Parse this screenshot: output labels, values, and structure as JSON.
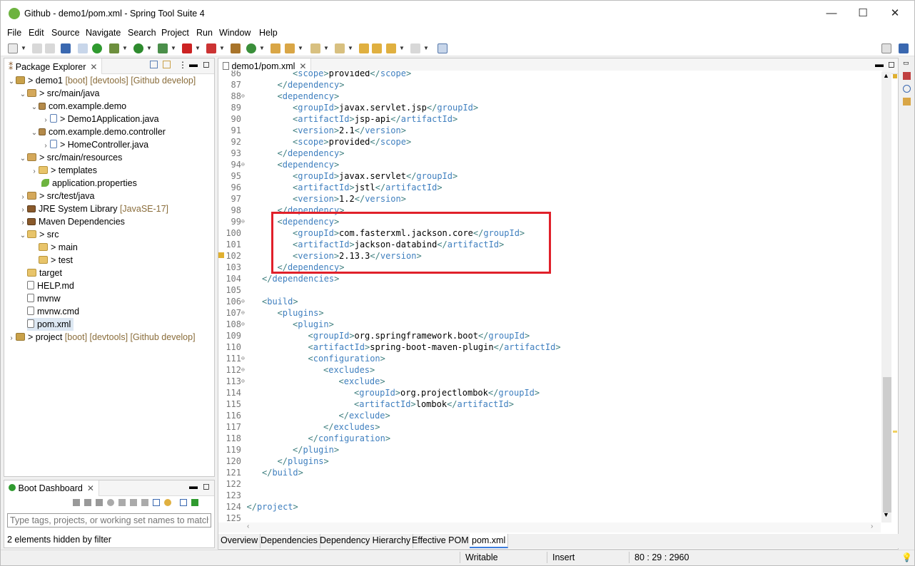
{
  "window": {
    "title": "Github - demo1/pom.xml - Spring Tool Suite 4",
    "minimize": "—",
    "maximize": "☐",
    "close": "✕"
  },
  "menu": [
    "File",
    "Edit",
    "Source",
    "Navigate",
    "Search",
    "Project",
    "Run",
    "Window",
    "Help"
  ],
  "package_explorer": {
    "tab_label": "Package Explorer",
    "tree": [
      {
        "label": "demo1",
        "deco": "[boot] [devtools] [Github develop]",
        "prefix": "> "
      },
      {
        "label": "src/main/java",
        "prefix": "> "
      },
      {
        "label": "com.example.demo"
      },
      {
        "label": "Demo1Application.java",
        "prefix": "> "
      },
      {
        "label": "com.example.demo.controller"
      },
      {
        "label": "HomeController.java",
        "prefix": "> "
      },
      {
        "label": "src/main/resources",
        "prefix": "> "
      },
      {
        "label": "templates",
        "prefix": "> "
      },
      {
        "label": "application.properties"
      },
      {
        "label": "src/test/java",
        "prefix": "> "
      },
      {
        "label": "JRE System Library",
        "deco": "[JavaSE-17]"
      },
      {
        "label": "Maven Dependencies"
      },
      {
        "label": "src",
        "prefix": "> "
      },
      {
        "label": "main",
        "prefix": "> "
      },
      {
        "label": "test",
        "prefix": "> "
      },
      {
        "label": "target"
      },
      {
        "label": "HELP.md"
      },
      {
        "label": "mvnw"
      },
      {
        "label": "mvnw.cmd"
      },
      {
        "label": "pom.xml"
      },
      {
        "label": "project",
        "deco": "[boot] [devtools] [Github develop]",
        "prefix": "> "
      }
    ]
  },
  "boot_dashboard": {
    "tab_label": "Boot Dashboard",
    "filter_placeholder": "Type tags, projects, or working set names to match",
    "hidden_text": "2 elements hidden by filter"
  },
  "editor": {
    "tab_label": "demo1/pom.xml",
    "lines": [
      {
        "n": "86",
        "indent": 2,
        "parts": [
          [
            "t",
            "<"
          ],
          [
            "n",
            "scope"
          ],
          [
            "x",
            ">provided</"
          ],
          [
            "n",
            "scope"
          ],
          [
            "t",
            ">"
          ]
        ]
      },
      {
        "n": "87",
        "indent": 1,
        "parts": [
          [
            "t",
            "</"
          ],
          [
            "n",
            "dependency"
          ],
          [
            "t",
            ">"
          ]
        ]
      },
      {
        "n": "88",
        "fold": true,
        "indent": 1,
        "parts": [
          [
            "t",
            "<"
          ],
          [
            "n",
            "dependency"
          ],
          [
            "t",
            ">"
          ]
        ]
      },
      {
        "n": "89",
        "indent": 2,
        "parts": [
          [
            "t",
            "<"
          ],
          [
            "n",
            "groupId"
          ],
          [
            "x",
            ">javax.servlet.jsp</"
          ],
          [
            "n",
            "groupId"
          ],
          [
            "t",
            ">"
          ]
        ]
      },
      {
        "n": "90",
        "indent": 2,
        "parts": [
          [
            "t",
            "<"
          ],
          [
            "n",
            "artifactId"
          ],
          [
            "x",
            ">jsp-api</"
          ],
          [
            "n",
            "artifactId"
          ],
          [
            "t",
            ">"
          ]
        ]
      },
      {
        "n": "91",
        "indent": 2,
        "parts": [
          [
            "t",
            "<"
          ],
          [
            "n",
            "version"
          ],
          [
            "x",
            ">2.1</"
          ],
          [
            "n",
            "version"
          ],
          [
            "t",
            ">"
          ]
        ]
      },
      {
        "n": "92",
        "indent": 2,
        "parts": [
          [
            "t",
            "<"
          ],
          [
            "n",
            "scope"
          ],
          [
            "x",
            ">provided</"
          ],
          [
            "n",
            "scope"
          ],
          [
            "t",
            ">"
          ]
        ]
      },
      {
        "n": "93",
        "indent": 1,
        "parts": [
          [
            "t",
            "</"
          ],
          [
            "n",
            "dependency"
          ],
          [
            "t",
            ">"
          ]
        ]
      },
      {
        "n": "94",
        "fold": true,
        "indent": 1,
        "parts": [
          [
            "t",
            "<"
          ],
          [
            "n",
            "dependency"
          ],
          [
            "t",
            ">"
          ]
        ]
      },
      {
        "n": "95",
        "indent": 2,
        "parts": [
          [
            "t",
            "<"
          ],
          [
            "n",
            "groupId"
          ],
          [
            "x",
            ">javax.servlet</"
          ],
          [
            "n",
            "groupId"
          ],
          [
            "t",
            ">"
          ]
        ]
      },
      {
        "n": "96",
        "indent": 2,
        "parts": [
          [
            "t",
            "<"
          ],
          [
            "n",
            "artifactId"
          ],
          [
            "x",
            ">jstl</"
          ],
          [
            "n",
            "artifactId"
          ],
          [
            "t",
            ">"
          ]
        ]
      },
      {
        "n": "97",
        "indent": 2,
        "parts": [
          [
            "t",
            "<"
          ],
          [
            "n",
            "version"
          ],
          [
            "x",
            ">1.2</"
          ],
          [
            "n",
            "version"
          ],
          [
            "t",
            ">"
          ]
        ]
      },
      {
        "n": "98",
        "indent": 1,
        "parts": [
          [
            "t",
            "</"
          ],
          [
            "n",
            "dependency"
          ],
          [
            "t",
            ">"
          ]
        ]
      },
      {
        "n": "99",
        "fold": true,
        "indent": 1,
        "parts": [
          [
            "t",
            "<"
          ],
          [
            "n",
            "dependency"
          ],
          [
            "t",
            ">"
          ]
        ]
      },
      {
        "n": "100",
        "indent": 2,
        "parts": [
          [
            "t",
            "<"
          ],
          [
            "n",
            "groupId"
          ],
          [
            "x",
            ">com.fasterxml.jackson.core</"
          ],
          [
            "n",
            "groupId"
          ],
          [
            "t",
            ">"
          ]
        ]
      },
      {
        "n": "101",
        "indent": 2,
        "parts": [
          [
            "t",
            "<"
          ],
          [
            "n",
            "artifactId"
          ],
          [
            "x",
            ">jackson-databind</"
          ],
          [
            "n",
            "artifactId"
          ],
          [
            "t",
            ">"
          ]
        ]
      },
      {
        "n": "102",
        "warn": true,
        "indent": 2,
        "parts": [
          [
            "t",
            "<"
          ],
          [
            "n",
            "version"
          ],
          [
            "x",
            ">2.13.3</"
          ],
          [
            "n",
            "version"
          ],
          [
            "t",
            ">"
          ]
        ]
      },
      {
        "n": "103",
        "indent": 1,
        "parts": [
          [
            "t",
            "</"
          ],
          [
            "n",
            "dependency"
          ],
          [
            "t",
            ">"
          ]
        ]
      },
      {
        "n": "104",
        "indent": 0,
        "parts": [
          [
            "t",
            "</"
          ],
          [
            "n",
            "dependencies"
          ],
          [
            "t",
            ">"
          ]
        ]
      },
      {
        "n": "105",
        "indent": 0,
        "parts": []
      },
      {
        "n": "106",
        "fold": true,
        "indent": 0,
        "parts": [
          [
            "t",
            "<"
          ],
          [
            "n",
            "build"
          ],
          [
            "t",
            ">"
          ]
        ]
      },
      {
        "n": "107",
        "fold": true,
        "indent": 1,
        "parts": [
          [
            "t",
            "<"
          ],
          [
            "n",
            "plugins"
          ],
          [
            "t",
            ">"
          ]
        ]
      },
      {
        "n": "108",
        "fold": true,
        "indent": 2,
        "parts": [
          [
            "t",
            "<"
          ],
          [
            "n",
            "plugin"
          ],
          [
            "t",
            ">"
          ]
        ]
      },
      {
        "n": "109",
        "indent": 3,
        "parts": [
          [
            "t",
            "<"
          ],
          [
            "n",
            "groupId"
          ],
          [
            "x",
            ">org.springframework.boot</"
          ],
          [
            "n",
            "groupId"
          ],
          [
            "t",
            ">"
          ]
        ]
      },
      {
        "n": "110",
        "indent": 3,
        "parts": [
          [
            "t",
            "<"
          ],
          [
            "n",
            "artifactId"
          ],
          [
            "x",
            ">spring-boot-maven-plugin</"
          ],
          [
            "n",
            "artifactId"
          ],
          [
            "t",
            ">"
          ]
        ]
      },
      {
        "n": "111",
        "fold": true,
        "indent": 3,
        "parts": [
          [
            "t",
            "<"
          ],
          [
            "n",
            "configuration"
          ],
          [
            "t",
            ">"
          ]
        ]
      },
      {
        "n": "112",
        "fold": true,
        "indent": 4,
        "parts": [
          [
            "t",
            "<"
          ],
          [
            "n",
            "excludes"
          ],
          [
            "t",
            ">"
          ]
        ]
      },
      {
        "n": "113",
        "fold": true,
        "indent": 5,
        "parts": [
          [
            "t",
            "<"
          ],
          [
            "n",
            "exclude"
          ],
          [
            "t",
            ">"
          ]
        ]
      },
      {
        "n": "114",
        "indent": 6,
        "parts": [
          [
            "t",
            "<"
          ],
          [
            "n",
            "groupId"
          ],
          [
            "x",
            ">org.projectlombok</"
          ],
          [
            "n",
            "groupId"
          ],
          [
            "t",
            ">"
          ]
        ]
      },
      {
        "n": "115",
        "indent": 6,
        "parts": [
          [
            "t",
            "<"
          ],
          [
            "n",
            "artifactId"
          ],
          [
            "x",
            ">lombok</"
          ],
          [
            "n",
            "artifactId"
          ],
          [
            "t",
            ">"
          ]
        ]
      },
      {
        "n": "116",
        "indent": 5,
        "parts": [
          [
            "t",
            "</"
          ],
          [
            "n",
            "exclude"
          ],
          [
            "t",
            ">"
          ]
        ]
      },
      {
        "n": "117",
        "indent": 4,
        "parts": [
          [
            "t",
            "</"
          ],
          [
            "n",
            "excludes"
          ],
          [
            "t",
            ">"
          ]
        ]
      },
      {
        "n": "118",
        "indent": 3,
        "parts": [
          [
            "t",
            "</"
          ],
          [
            "n",
            "configuration"
          ],
          [
            "t",
            ">"
          ]
        ]
      },
      {
        "n": "119",
        "indent": 2,
        "parts": [
          [
            "t",
            "</"
          ],
          [
            "n",
            "plugin"
          ],
          [
            "t",
            ">"
          ]
        ]
      },
      {
        "n": "120",
        "indent": 1,
        "parts": [
          [
            "t",
            "</"
          ],
          [
            "n",
            "plugins"
          ],
          [
            "t",
            ">"
          ]
        ]
      },
      {
        "n": "121",
        "indent": 0,
        "parts": [
          [
            "t",
            "</"
          ],
          [
            "n",
            "build"
          ],
          [
            "t",
            ">"
          ]
        ]
      },
      {
        "n": "122",
        "indent": 0,
        "parts": []
      },
      {
        "n": "123",
        "indent": 0,
        "parts": []
      },
      {
        "n": "124",
        "indent": -1,
        "parts": [
          [
            "t",
            "</"
          ],
          [
            "n",
            "project"
          ],
          [
            "t",
            ">"
          ]
        ]
      },
      {
        "n": "125",
        "indent": 0,
        "parts": []
      }
    ]
  },
  "editor_tabs": [
    "Overview",
    "Dependencies",
    "Dependency Hierarchy",
    "Effective POM",
    "pom.xml"
  ],
  "status": {
    "writable": "Writable",
    "insert": "Insert",
    "position": "80 : 29 : 2960"
  },
  "highlight_color": "#e0202a"
}
